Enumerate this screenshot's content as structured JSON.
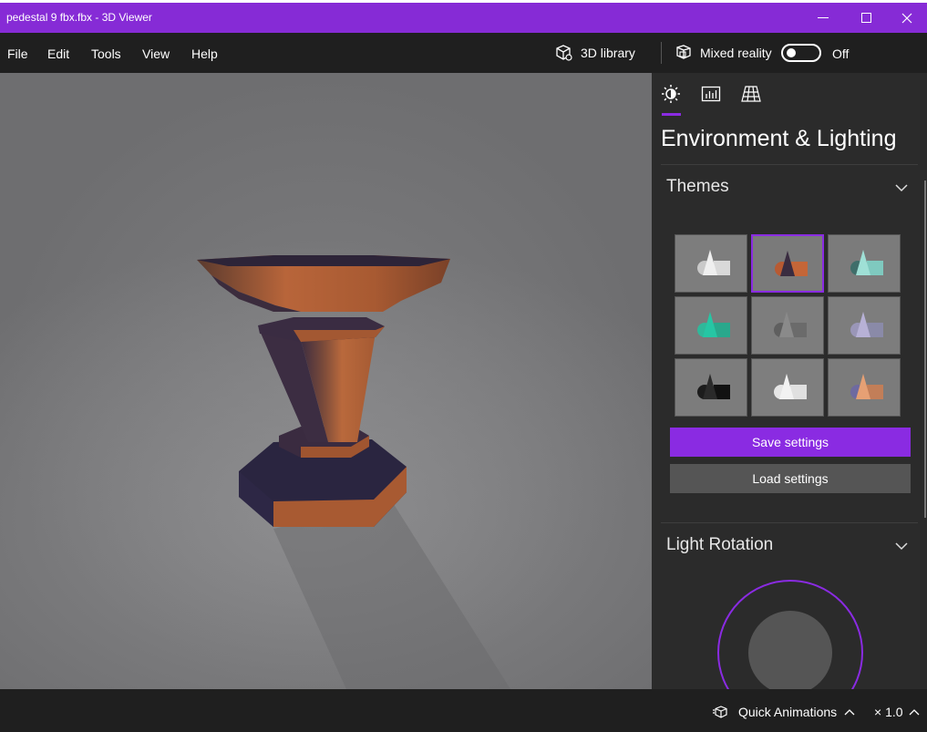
{
  "window": {
    "title": "pedestal 9 fbx.fbx - 3D Viewer"
  },
  "menu": {
    "items": [
      {
        "label": "File"
      },
      {
        "label": "Edit"
      },
      {
        "label": "Tools"
      },
      {
        "label": "View"
      },
      {
        "label": "Help"
      }
    ],
    "library_label": "3D library",
    "mixed_reality_label": "Mixed reality",
    "mixed_reality_state": "Off"
  },
  "panel": {
    "tabs": [
      "lighting-tab",
      "stats-tab",
      "grid-tab"
    ],
    "title": "Environment & Lighting",
    "themes_label": "Themes",
    "selected_theme_index": 1,
    "save_label": "Save settings",
    "load_label": "Load settings",
    "light_rotation_label": "Light Rotation"
  },
  "bottom": {
    "quick_animations_label": "Quick Animations",
    "speed_label": "× 1.0"
  },
  "colors": {
    "accent": "#8a2be2",
    "title_bar": "#862bd6",
    "panel_bg": "#2b2b2b",
    "bar_bg": "#1f1f1f"
  }
}
